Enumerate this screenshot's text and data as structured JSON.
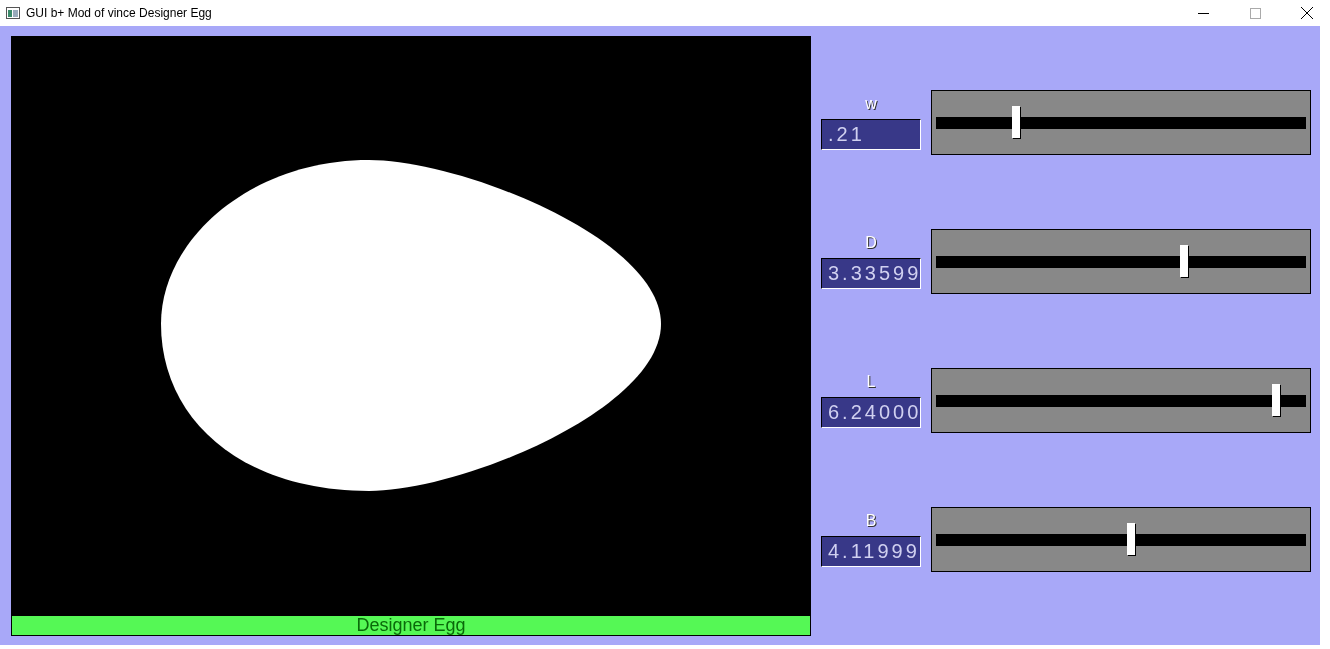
{
  "window": {
    "title": "GUI b+ Mod of vince Designer Egg"
  },
  "canvas": {
    "caption": "Designer Egg"
  },
  "sliders": [
    {
      "label": "w",
      "value": ".21",
      "level": 0.215
    },
    {
      "label": "D",
      "value": "3.33599",
      "level": 0.67
    },
    {
      "label": "L",
      "value": "6.24000",
      "level": 0.92
    },
    {
      "label": "B",
      "value": "4.11999",
      "level": 0.527
    }
  ]
}
